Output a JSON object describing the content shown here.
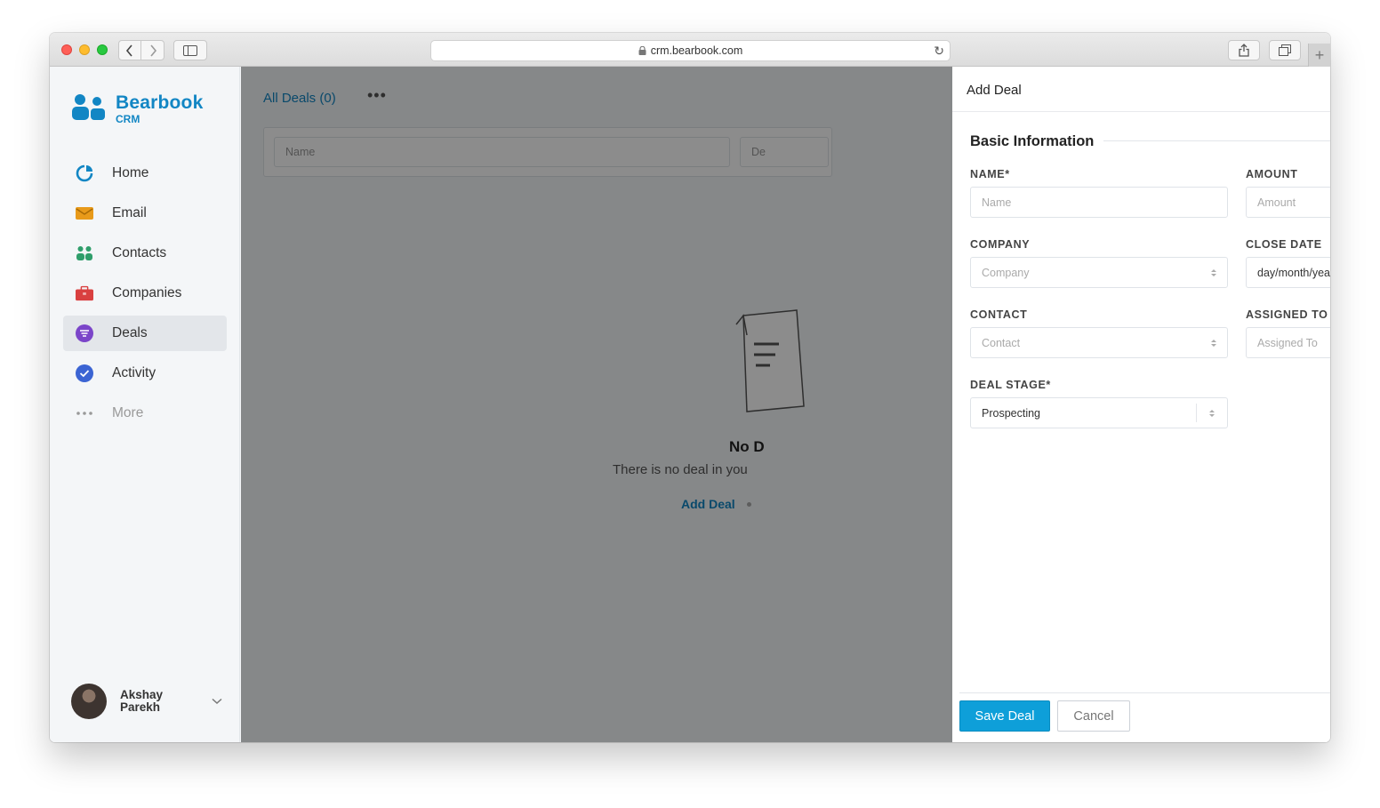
{
  "browser": {
    "url": "crm.bearbook.com"
  },
  "brand": {
    "name": "Bearbook",
    "sub": "CRM",
    "color": "#1286c4"
  },
  "sidebar": {
    "items": [
      {
        "label": "Home",
        "icon": "pie-chart-icon",
        "color": "#1286c4"
      },
      {
        "label": "Email",
        "icon": "envelope-icon",
        "color": "#e89a1a"
      },
      {
        "label": "Contacts",
        "icon": "people-icon",
        "color": "#2f9e6b"
      },
      {
        "label": "Companies",
        "icon": "briefcase-icon",
        "color": "#d94040"
      },
      {
        "label": "Deals",
        "icon": "filter-icon",
        "color": "#7b45c9"
      },
      {
        "label": "Activity",
        "icon": "check-circle-icon",
        "color": "#3b64d3"
      },
      {
        "label": "More",
        "icon": "ellipsis-icon",
        "color": "#999999"
      }
    ],
    "user": {
      "first": "Akshay",
      "last": "Parekh"
    }
  },
  "main": {
    "title": "All Deals (0)",
    "filter_name_placeholder": "Name",
    "filter_second_placeholder": "De",
    "empty_title": "No D",
    "empty_desc": "There is no deal in you",
    "empty_add": "Add Deal"
  },
  "drawer": {
    "title": "Add Deal",
    "section": "Basic Information",
    "fields": {
      "name": {
        "label": "NAME*",
        "placeholder": "Name"
      },
      "amount": {
        "label": "AMOUNT",
        "placeholder": "Amount"
      },
      "company": {
        "label": "COMPANY",
        "placeholder": "Company"
      },
      "close_date": {
        "label": "CLOSE DATE",
        "value": "day/month/year"
      },
      "contact": {
        "label": "CONTACT",
        "placeholder": "Contact"
      },
      "assigned_to": {
        "label": "ASSIGNED TO",
        "placeholder": "Assigned To"
      },
      "deal_stage": {
        "label": "DEAL STAGE*",
        "value": "Prospecting"
      }
    },
    "save_label": "Save Deal",
    "cancel_label": "Cancel",
    "accent": "#0e9fd9"
  }
}
